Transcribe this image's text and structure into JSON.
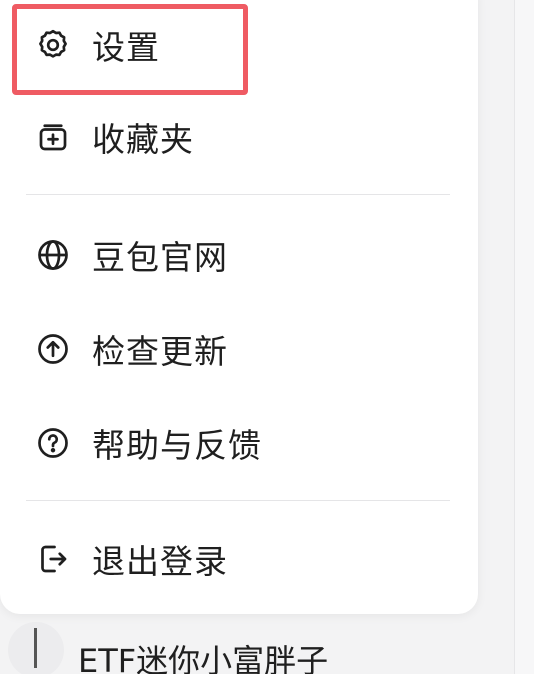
{
  "menu": {
    "items": [
      {
        "id": "settings",
        "label": "设置",
        "icon": "gear-icon"
      },
      {
        "id": "favorites",
        "label": "收藏夹",
        "icon": "bookmark-plus-icon"
      },
      {
        "id": "website",
        "label": "豆包官网",
        "icon": "globe-icon"
      },
      {
        "id": "update",
        "label": "检查更新",
        "icon": "arrow-up-circle-icon"
      },
      {
        "id": "help",
        "label": "帮助与反馈",
        "icon": "question-circle-icon"
      },
      {
        "id": "logout",
        "label": "退出登录",
        "icon": "logout-icon"
      }
    ]
  },
  "chat_list": {
    "items": [
      {
        "title": "ETF迷你小富胖子"
      }
    ]
  },
  "colors": {
    "highlight_border": "#ef5b63",
    "menu_background": "#ffffff",
    "page_background": "#f3f3f4"
  }
}
